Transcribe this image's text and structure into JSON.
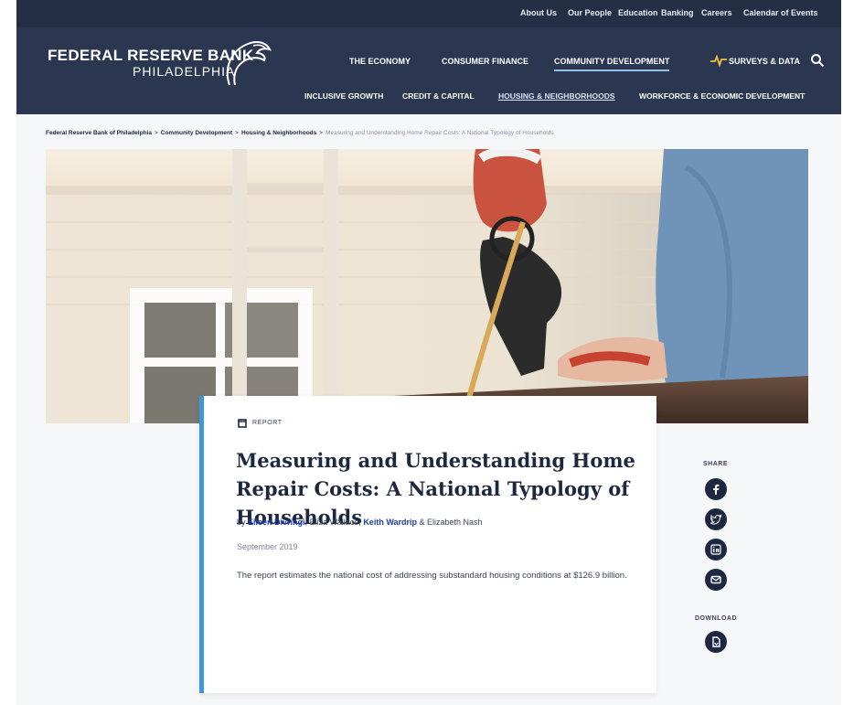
{
  "utility_nav": [
    {
      "label": "About Us"
    },
    {
      "label": "Our People"
    },
    {
      "label": "Education"
    },
    {
      "label": "Banking"
    },
    {
      "label": "Careers"
    },
    {
      "label": "Calendar of Events"
    }
  ],
  "logo": {
    "line1": "FEDERAL RESERVE BANK",
    "line2": "PHILADELPHIA",
    "icon": "eagle-logo-icon"
  },
  "main_nav": [
    {
      "label": "THE ECONOMY"
    },
    {
      "label": "CONSUMER FINANCE"
    },
    {
      "label": "COMMUNITY DEVELOPMENT",
      "active": true
    },
    {
      "label": "SURVEYS & DATA",
      "icon": "pulse-icon"
    }
  ],
  "sub_nav": [
    {
      "label": "INCLUSIVE GROWTH"
    },
    {
      "label": "CREDIT & CAPITAL"
    },
    {
      "label": "HOUSING & NEIGHBORHOODS",
      "active": true
    },
    {
      "label": "WORKFORCE & ECONOMIC DEVELOPMENT"
    }
  ],
  "breadcrumb": [
    {
      "label": "Federal Reserve Bank of Philadelphia"
    },
    {
      "label": "Community Development"
    },
    {
      "label": "Housing & Neighborhoods"
    },
    {
      "label": "Measuring and Understanding Home Repair Costs: A National Typology of Households"
    }
  ],
  "breadcrumb_separator": ">",
  "article": {
    "type_label": "REPORT",
    "title": "Measuring and Understanding Home Repair Costs: A National Typology of Households",
    "byline_prefix": "by",
    "authors": [
      {
        "name": "Eileen Divringi",
        "linked": true
      },
      {
        "name": "Eliza Wallace",
        "linked": false
      },
      {
        "name": "Keith Wardrip",
        "linked": true
      },
      {
        "name": "Elizabeth Nash",
        "linked": false
      }
    ],
    "byline_sep1": ",",
    "byline_sep2": ",",
    "byline_sep3": "&",
    "date": "September 2019",
    "summary": "The report estimates the national cost of addressing substandard housing conditions at $126.9 billion."
  },
  "share": {
    "label": "SHARE",
    "buttons": [
      {
        "icon": "facebook-icon"
      },
      {
        "icon": "twitter-icon"
      },
      {
        "icon": "linkedin-icon"
      },
      {
        "icon": "email-icon"
      }
    ]
  },
  "download": {
    "label": "DOWNLOAD",
    "icon": "download-document-icon"
  },
  "colors": {
    "header_bg": "#2b3650",
    "accent_blue": "#3a9ad9",
    "link_blue": "#1f3fae",
    "navy": "#1d2840",
    "pulse": "#f2c230"
  }
}
